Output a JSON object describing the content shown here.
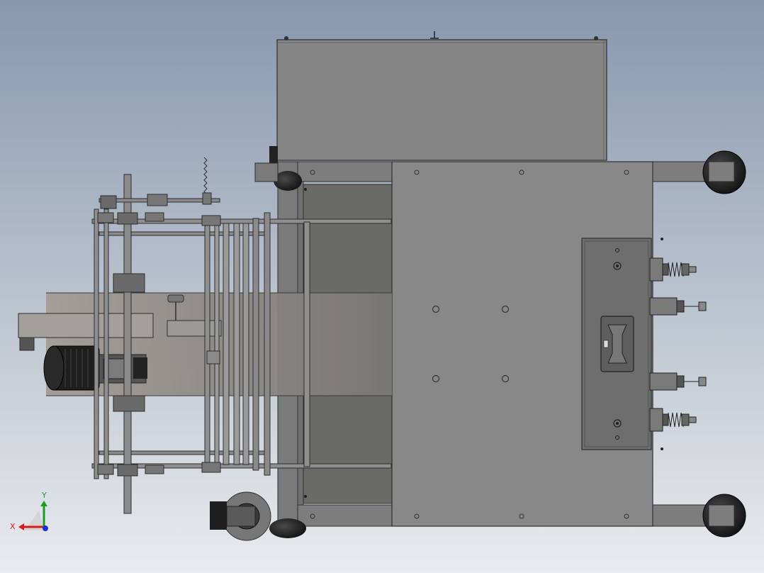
{
  "colors": {
    "bg_top": "#8797ad",
    "bg_bottom": "#e9ebee",
    "panel": "#848484",
    "panel_dark": "#6a6a68",
    "frame": "#7b7b7b",
    "edge": "#2e2e2e",
    "conveyor": "#9a9690",
    "motor": "#1c1c1c",
    "wheel": "#1a1a1a",
    "axis_x": "#d81b1b",
    "axis_y": "#18a018",
    "axis_z": "#1730d0"
  },
  "triad": {
    "x_label": "X",
    "y_label": "Y"
  }
}
